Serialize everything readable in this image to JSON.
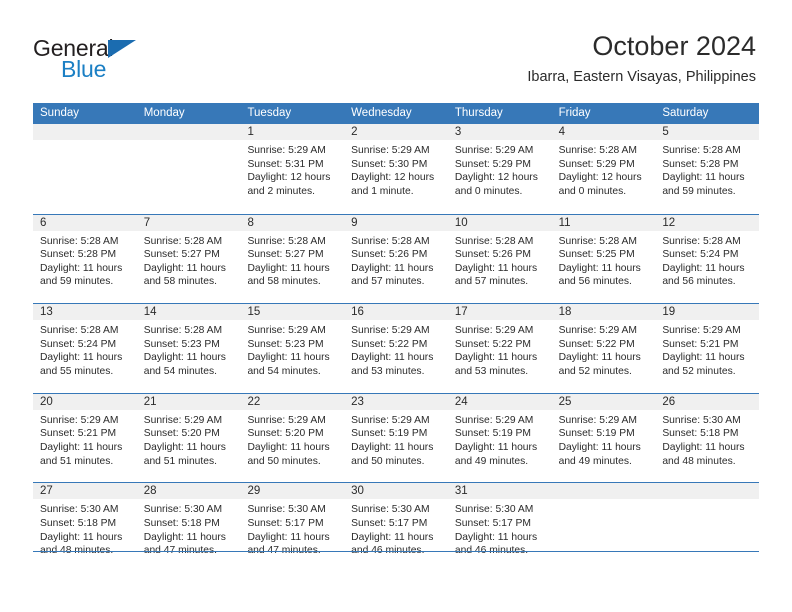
{
  "brand": {
    "name_top": "General",
    "name_bottom": "Blue",
    "accent_color": "#1b7fc4",
    "triangle_icon": "triangle-icon"
  },
  "header": {
    "title": "October 2024",
    "location": "Ibarra, Eastern Visayas, Philippines"
  },
  "calendar": {
    "header_bg": "#3778b8",
    "datebar_bg": "#f0f0f0",
    "weekdays": [
      "Sunday",
      "Monday",
      "Tuesday",
      "Wednesday",
      "Thursday",
      "Friday",
      "Saturday"
    ],
    "weeks": [
      [
        {
          "day": "",
          "lines": []
        },
        {
          "day": "",
          "lines": []
        },
        {
          "day": "1",
          "lines": [
            "Sunrise: 5:29 AM",
            "Sunset: 5:31 PM",
            "Daylight: 12 hours",
            "and 2 minutes."
          ]
        },
        {
          "day": "2",
          "lines": [
            "Sunrise: 5:29 AM",
            "Sunset: 5:30 PM",
            "Daylight: 12 hours",
            "and 1 minute."
          ]
        },
        {
          "day": "3",
          "lines": [
            "Sunrise: 5:29 AM",
            "Sunset: 5:29 PM",
            "Daylight: 12 hours",
            "and 0 minutes."
          ]
        },
        {
          "day": "4",
          "lines": [
            "Sunrise: 5:28 AM",
            "Sunset: 5:29 PM",
            "Daylight: 12 hours",
            "and 0 minutes."
          ]
        },
        {
          "day": "5",
          "lines": [
            "Sunrise: 5:28 AM",
            "Sunset: 5:28 PM",
            "Daylight: 11 hours",
            "and 59 minutes."
          ]
        }
      ],
      [
        {
          "day": "6",
          "lines": [
            "Sunrise: 5:28 AM",
            "Sunset: 5:28 PM",
            "Daylight: 11 hours",
            "and 59 minutes."
          ]
        },
        {
          "day": "7",
          "lines": [
            "Sunrise: 5:28 AM",
            "Sunset: 5:27 PM",
            "Daylight: 11 hours",
            "and 58 minutes."
          ]
        },
        {
          "day": "8",
          "lines": [
            "Sunrise: 5:28 AM",
            "Sunset: 5:27 PM",
            "Daylight: 11 hours",
            "and 58 minutes."
          ]
        },
        {
          "day": "9",
          "lines": [
            "Sunrise: 5:28 AM",
            "Sunset: 5:26 PM",
            "Daylight: 11 hours",
            "and 57 minutes."
          ]
        },
        {
          "day": "10",
          "lines": [
            "Sunrise: 5:28 AM",
            "Sunset: 5:26 PM",
            "Daylight: 11 hours",
            "and 57 minutes."
          ]
        },
        {
          "day": "11",
          "lines": [
            "Sunrise: 5:28 AM",
            "Sunset: 5:25 PM",
            "Daylight: 11 hours",
            "and 56 minutes."
          ]
        },
        {
          "day": "12",
          "lines": [
            "Sunrise: 5:28 AM",
            "Sunset: 5:24 PM",
            "Daylight: 11 hours",
            "and 56 minutes."
          ]
        }
      ],
      [
        {
          "day": "13",
          "lines": [
            "Sunrise: 5:28 AM",
            "Sunset: 5:24 PM",
            "Daylight: 11 hours",
            "and 55 minutes."
          ]
        },
        {
          "day": "14",
          "lines": [
            "Sunrise: 5:28 AM",
            "Sunset: 5:23 PM",
            "Daylight: 11 hours",
            "and 54 minutes."
          ]
        },
        {
          "day": "15",
          "lines": [
            "Sunrise: 5:29 AM",
            "Sunset: 5:23 PM",
            "Daylight: 11 hours",
            "and 54 minutes."
          ]
        },
        {
          "day": "16",
          "lines": [
            "Sunrise: 5:29 AM",
            "Sunset: 5:22 PM",
            "Daylight: 11 hours",
            "and 53 minutes."
          ]
        },
        {
          "day": "17",
          "lines": [
            "Sunrise: 5:29 AM",
            "Sunset: 5:22 PM",
            "Daylight: 11 hours",
            "and 53 minutes."
          ]
        },
        {
          "day": "18",
          "lines": [
            "Sunrise: 5:29 AM",
            "Sunset: 5:22 PM",
            "Daylight: 11 hours",
            "and 52 minutes."
          ]
        },
        {
          "day": "19",
          "lines": [
            "Sunrise: 5:29 AM",
            "Sunset: 5:21 PM",
            "Daylight: 11 hours",
            "and 52 minutes."
          ]
        }
      ],
      [
        {
          "day": "20",
          "lines": [
            "Sunrise: 5:29 AM",
            "Sunset: 5:21 PM",
            "Daylight: 11 hours",
            "and 51 minutes."
          ]
        },
        {
          "day": "21",
          "lines": [
            "Sunrise: 5:29 AM",
            "Sunset: 5:20 PM",
            "Daylight: 11 hours",
            "and 51 minutes."
          ]
        },
        {
          "day": "22",
          "lines": [
            "Sunrise: 5:29 AM",
            "Sunset: 5:20 PM",
            "Daylight: 11 hours",
            "and 50 minutes."
          ]
        },
        {
          "day": "23",
          "lines": [
            "Sunrise: 5:29 AM",
            "Sunset: 5:19 PM",
            "Daylight: 11 hours",
            "and 50 minutes."
          ]
        },
        {
          "day": "24",
          "lines": [
            "Sunrise: 5:29 AM",
            "Sunset: 5:19 PM",
            "Daylight: 11 hours",
            "and 49 minutes."
          ]
        },
        {
          "day": "25",
          "lines": [
            "Sunrise: 5:29 AM",
            "Sunset: 5:19 PM",
            "Daylight: 11 hours",
            "and 49 minutes."
          ]
        },
        {
          "day": "26",
          "lines": [
            "Sunrise: 5:30 AM",
            "Sunset: 5:18 PM",
            "Daylight: 11 hours",
            "and 48 minutes."
          ]
        }
      ],
      [
        {
          "day": "27",
          "lines": [
            "Sunrise: 5:30 AM",
            "Sunset: 5:18 PM",
            "Daylight: 11 hours",
            "and 48 minutes."
          ]
        },
        {
          "day": "28",
          "lines": [
            "Sunrise: 5:30 AM",
            "Sunset: 5:18 PM",
            "Daylight: 11 hours",
            "and 47 minutes."
          ]
        },
        {
          "day": "29",
          "lines": [
            "Sunrise: 5:30 AM",
            "Sunset: 5:17 PM",
            "Daylight: 11 hours",
            "and 47 minutes."
          ]
        },
        {
          "day": "30",
          "lines": [
            "Sunrise: 5:30 AM",
            "Sunset: 5:17 PM",
            "Daylight: 11 hours",
            "and 46 minutes."
          ]
        },
        {
          "day": "31",
          "lines": [
            "Sunrise: 5:30 AM",
            "Sunset: 5:17 PM",
            "Daylight: 11 hours",
            "and 46 minutes."
          ]
        },
        {
          "day": "",
          "lines": []
        },
        {
          "day": "",
          "lines": []
        }
      ]
    ]
  }
}
